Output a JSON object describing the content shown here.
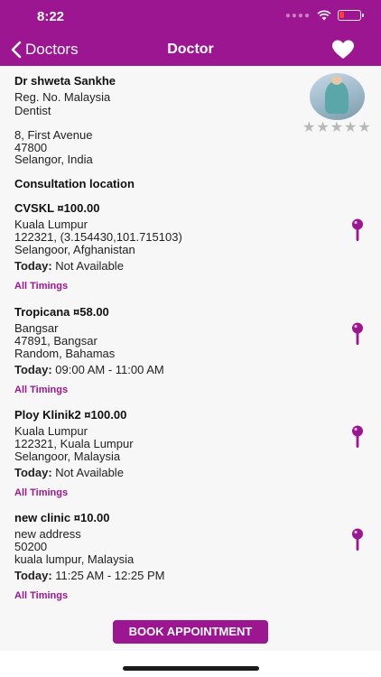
{
  "status_bar": {
    "time": "8:22"
  },
  "nav": {
    "back_label": "Doctors",
    "title": "Doctor"
  },
  "doctor": {
    "name": "Dr shweta Sankhe",
    "reg": "Reg. No. Malaysia",
    "specialty": "Dentist",
    "address": [
      "8, First Avenue",
      "47800",
      "Selangor, India"
    ],
    "rating": 0,
    "rating_max": 5
  },
  "section_title": "Consultation location",
  "clinics": [
    {
      "name": "CVSKL ¤100.00",
      "lines": [
        "Kuala Lumpur",
        "122321, (3.154430,101.715103)",
        "Selangoor, Afghanistan"
      ],
      "today_label": "Today:",
      "today_value": "Not Available",
      "timings_label": "All Timings"
    },
    {
      "name": "Tropicana ¤58.00",
      "lines": [
        "Bangsar",
        "47891, Bangsar",
        "Random, Bahamas"
      ],
      "today_label": "Today:",
      "today_value": "09:00 AM - 11:00 AM",
      "timings_label": "All Timings"
    },
    {
      "name": "Ploy Klinik2 ¤100.00",
      "lines": [
        "Kuala Lumpur",
        "122321, Kuala Lumpur",
        "Selangoor, Malaysia"
      ],
      "today_label": "Today:",
      "today_value": "Not Available",
      "timings_label": "All Timings"
    },
    {
      "name": "new clinic ¤10.00",
      "lines": [
        "new address",
        "50200",
        "kuala lumpur, Malaysia"
      ],
      "today_label": "Today:",
      "today_value": "11:25 AM - 12:25 PM",
      "timings_label": "All Timings"
    }
  ],
  "book_button": "BOOK APPOINTMENT",
  "colors": {
    "primary": "#9c1591",
    "background": "#f7f7f7",
    "star": "#b8b8b8"
  },
  "icons": [
    "back-chevron-icon",
    "wifi-icon",
    "battery-icon",
    "heart-icon",
    "map-pin-icon",
    "star-icon"
  ]
}
